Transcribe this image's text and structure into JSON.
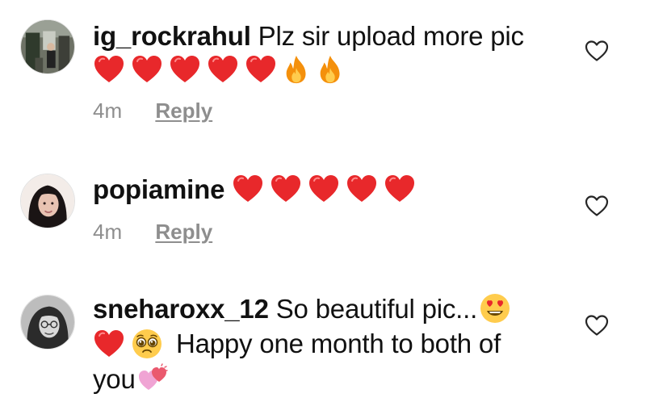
{
  "comments": [
    {
      "username": "ig_rockrahul",
      "text": "Plz sir upload more pic",
      "time": "4m",
      "reply": "Reply",
      "emojis": [
        "red-heart",
        "red-heart",
        "red-heart",
        "red-heart",
        "red-heart",
        "fire",
        "fire"
      ]
    },
    {
      "username": "popiamine",
      "text": "",
      "time": "4m",
      "reply": "Reply",
      "emojis": [
        "red-heart",
        "red-heart",
        "red-heart",
        "red-heart",
        "red-heart"
      ]
    },
    {
      "username": "sneharoxx_12",
      "text_line1": "So beautiful pic...",
      "text_line2": "Happy one month to both of",
      "text_line3": "you",
      "emojis": [
        "heart-eyes",
        "red-heart",
        "pleading-face",
        "two-hearts"
      ]
    }
  ],
  "icons": {
    "like": "heart-outline-icon"
  },
  "colors": {
    "text": "#111111",
    "meta": "#8e8e8e",
    "heart": "#e8282b"
  }
}
